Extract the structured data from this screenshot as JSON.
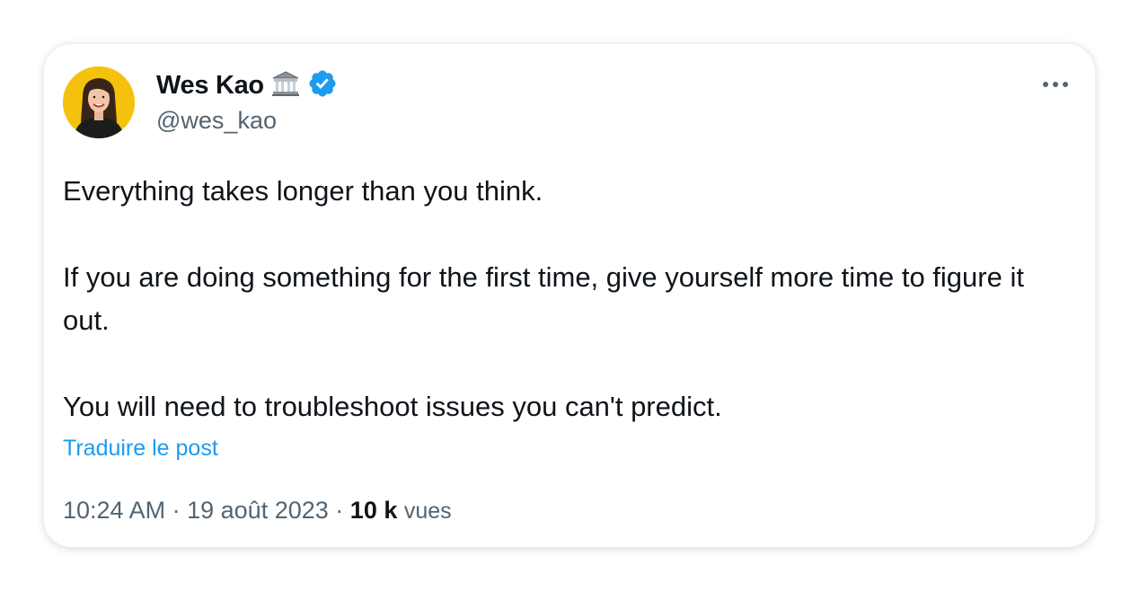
{
  "author": {
    "display_name": "Wes Kao",
    "handle": "@wes_kao",
    "affiliate_badge": "classical-building-emoji",
    "verified_badge": "verified-badge-icon"
  },
  "tweet": {
    "paragraphs": [
      "Everything takes longer than you think.",
      "If you are doing something for the first time, give yourself more time to figure it out.",
      "You will need to troubleshoot issues you can't predict."
    ],
    "translate_label": "Traduire le post"
  },
  "meta": {
    "time": "10:24 AM",
    "separator": "·",
    "date": "19 août 2023",
    "views_count": "10 k",
    "views_label": "vues"
  },
  "colors": {
    "text": "#0f1419",
    "secondary": "#536471",
    "link": "#1d9bf0",
    "verified": "#1d9bf0"
  },
  "icons": {
    "more": "more-horizontal-icon"
  }
}
